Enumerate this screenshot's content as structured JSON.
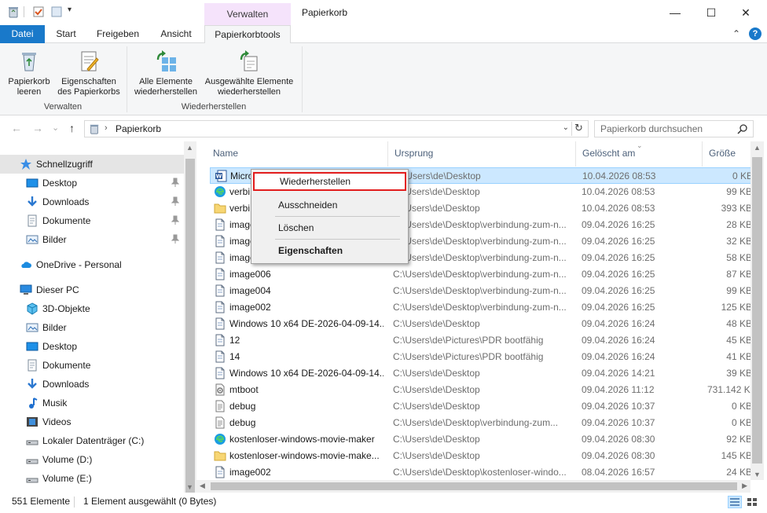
{
  "titlebar": {
    "context_tab": "Verwalten",
    "title": "Papierkorb",
    "minimize": "—",
    "maximize": "☐",
    "close": "✕"
  },
  "ribbon_tabs": {
    "file": "Datei",
    "start": "Start",
    "share": "Freigeben",
    "view": "Ansicht",
    "tools": "Papierkorbtools",
    "collapse": "⌃",
    "help": "?"
  },
  "ribbon": {
    "empty_bin": [
      "Papierkorb",
      "leeren"
    ],
    "properties": [
      "Eigenschaften",
      "des Papierkorbs"
    ],
    "group_manage": "Verwalten",
    "restore_all": [
      "Alle Elemente",
      "wiederherstellen"
    ],
    "restore_selected": [
      "Ausgewählte Elemente",
      "wiederherstellen"
    ],
    "group_restore": "Wiederherstellen"
  },
  "address": {
    "back": "←",
    "forward": "→",
    "recent": "⌄",
    "up": "↑",
    "path": "Papierkorb",
    "search_placeholder": "Papierkorb durchsuchen"
  },
  "nav": [
    {
      "label": "Schnellzugriff",
      "icon": "star-icon",
      "indent": 0,
      "sel": true
    },
    {
      "label": "Desktop",
      "icon": "desktop-icon",
      "indent": 1,
      "pin": true
    },
    {
      "label": "Downloads",
      "icon": "download-icon",
      "indent": 1,
      "pin": true
    },
    {
      "label": "Dokumente",
      "icon": "documents-icon",
      "indent": 1,
      "pin": true
    },
    {
      "label": "Bilder",
      "icon": "pictures-icon",
      "indent": 1,
      "pin": true
    },
    {
      "label": "OneDrive - Personal",
      "icon": "cloud-icon",
      "indent": 0,
      "gap": true
    },
    {
      "label": "Dieser PC",
      "icon": "pc-icon",
      "indent": 0,
      "gap": true
    },
    {
      "label": "3D-Objekte",
      "icon": "cube-icon",
      "indent": 1
    },
    {
      "label": "Bilder",
      "icon": "pictures-icon",
      "indent": 1
    },
    {
      "label": "Desktop",
      "icon": "desktop-icon",
      "indent": 1
    },
    {
      "label": "Dokumente",
      "icon": "documents-icon",
      "indent": 1
    },
    {
      "label": "Downloads",
      "icon": "download-icon",
      "indent": 1
    },
    {
      "label": "Musik",
      "icon": "music-icon",
      "indent": 1
    },
    {
      "label": "Videos",
      "icon": "video-icon",
      "indent": 1
    },
    {
      "label": "Lokaler Datenträger (C:)",
      "icon": "drive-icon",
      "indent": 1
    },
    {
      "label": "Volume (D:)",
      "icon": "drive-icon",
      "indent": 1
    },
    {
      "label": "Volume (E:)",
      "icon": "drive-icon",
      "indent": 1
    }
  ],
  "columns": {
    "name": "Name",
    "origin": "Ursprung",
    "deleted": "Gelöscht am",
    "size": "Größe"
  },
  "files": [
    {
      "name": "Micro",
      "icon": "word-icon",
      "origin": "C:\\Users\\de\\Desktop",
      "deleted": "10.04.2026 08:53",
      "size": "0 KB",
      "sel": true
    },
    {
      "name": "verbi",
      "icon": "edge-icon",
      "origin": "C:\\Users\\de\\Desktop",
      "deleted": "10.04.2026 08:53",
      "size": "99 KB"
    },
    {
      "name": "verbi",
      "icon": "folder-icon",
      "origin": "C:\\Users\\de\\Desktop",
      "deleted": "10.04.2026 08:53",
      "size": "393 KB"
    },
    {
      "name": "image",
      "icon": "file-icon",
      "origin": "C:\\Users\\de\\Desktop\\verbindung-zum-n...",
      "deleted": "09.04.2026 16:25",
      "size": "28 KB"
    },
    {
      "name": "image",
      "icon": "file-icon",
      "origin": "C:\\Users\\de\\Desktop\\verbindung-zum-n...",
      "deleted": "09.04.2026 16:25",
      "size": "32 KB"
    },
    {
      "name": "image",
      "icon": "file-icon",
      "origin": "C:\\Users\\de\\Desktop\\verbindung-zum-n...",
      "deleted": "09.04.2026 16:25",
      "size": "58 KB"
    },
    {
      "name": "image006",
      "icon": "file-icon",
      "origin": "C:\\Users\\de\\Desktop\\verbindung-zum-n...",
      "deleted": "09.04.2026 16:25",
      "size": "87 KB"
    },
    {
      "name": "image004",
      "icon": "file-icon",
      "origin": "C:\\Users\\de\\Desktop\\verbindung-zum-n...",
      "deleted": "09.04.2026 16:25",
      "size": "99 KB"
    },
    {
      "name": "image002",
      "icon": "file-icon",
      "origin": "C:\\Users\\de\\Desktop\\verbindung-zum-n...",
      "deleted": "09.04.2026 16:25",
      "size": "125 KB"
    },
    {
      "name": "Windows 10 x64 DE-2026-04-09-14...",
      "icon": "file-icon",
      "origin": "C:\\Users\\de\\Desktop",
      "deleted": "09.04.2026 16:24",
      "size": "48 KB"
    },
    {
      "name": "12",
      "icon": "file-icon",
      "origin": "C:\\Users\\de\\Pictures\\PDR bootfähig",
      "deleted": "09.04.2026 16:24",
      "size": "45 KB"
    },
    {
      "name": "14",
      "icon": "file-icon",
      "origin": "C:\\Users\\de\\Pictures\\PDR bootfähig",
      "deleted": "09.04.2026 16:24",
      "size": "41 KB"
    },
    {
      "name": "Windows 10 x64 DE-2026-04-09-14...",
      "icon": "file-icon",
      "origin": "C:\\Users\\de\\Desktop",
      "deleted": "09.04.2026 14:21",
      "size": "39 KB"
    },
    {
      "name": "mtboot",
      "icon": "gear-file-icon",
      "origin": "C:\\Users\\de\\Desktop",
      "deleted": "09.04.2026 11:12",
      "size": "731.142 KB"
    },
    {
      "name": "debug",
      "icon": "text-file-icon",
      "origin": "C:\\Users\\de\\Desktop",
      "deleted": "09.04.2026 10:37",
      "size": "0 KB"
    },
    {
      "name": "debug",
      "icon": "text-file-icon",
      "origin": "C:\\Users\\de\\Desktop\\verbindung-zum...",
      "deleted": "09.04.2026 10:37",
      "size": "0 KB"
    },
    {
      "name": "kostenloser-windows-movie-maker",
      "icon": "edge-icon",
      "origin": "C:\\Users\\de\\Desktop",
      "deleted": "09.04.2026 08:30",
      "size": "92 KB"
    },
    {
      "name": "kostenloser-windows-movie-make...",
      "icon": "folder-icon",
      "origin": "C:\\Users\\de\\Desktop",
      "deleted": "09.04.2026 08:30",
      "size": "145 KB"
    },
    {
      "name": "image002",
      "icon": "file-icon",
      "origin": "C:\\Users\\de\\Desktop\\kostenloser-windo...",
      "deleted": "08.04.2026 16:57",
      "size": "24 KB"
    }
  ],
  "context_menu": {
    "restore": "Wiederherstellen",
    "cut": "Ausschneiden",
    "delete": "Löschen",
    "properties": "Eigenschaften"
  },
  "status": {
    "count": "551 Elemente",
    "selection": "1 Element ausgewählt (0 Bytes)"
  },
  "colors": {
    "accent": "#1979ca",
    "selection": "#cce8ff",
    "highlight_border": "#e21d1d",
    "context_tab": "#f5e3fb"
  }
}
